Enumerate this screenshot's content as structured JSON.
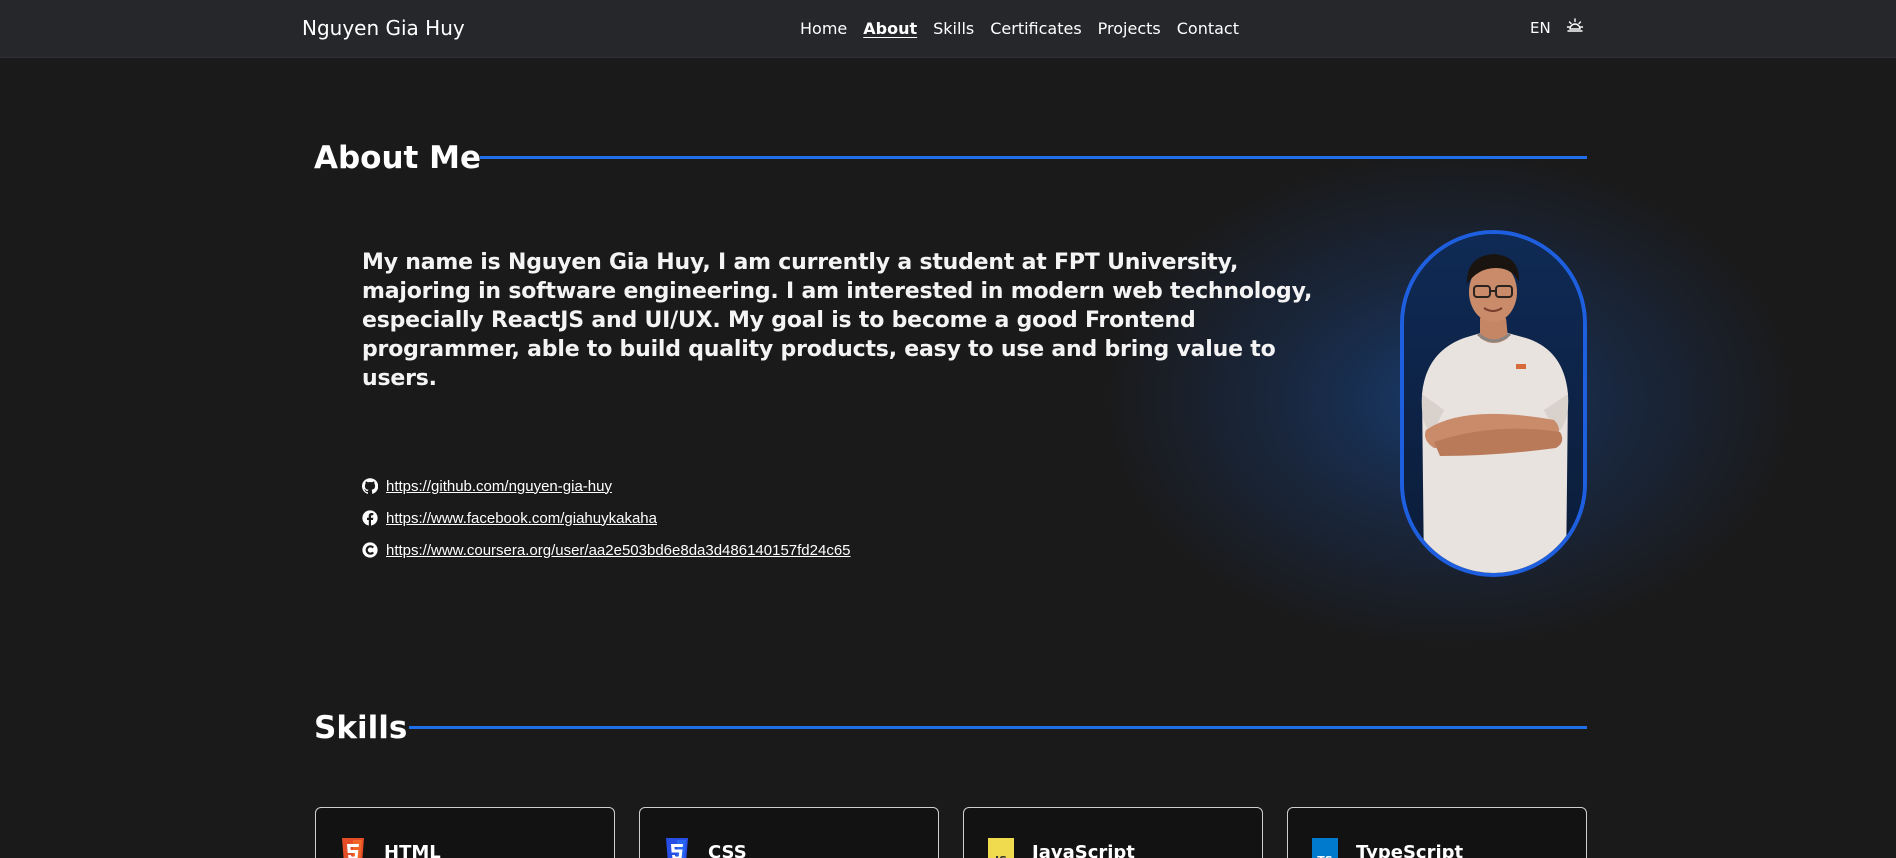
{
  "nav": {
    "brand": "Nguyen Gia Huy",
    "links": [
      "Home",
      "About",
      "Skills",
      "Certificates",
      "Projects",
      "Contact"
    ],
    "active": "About",
    "language": "EN",
    "theme_icon": "sun-icon"
  },
  "about": {
    "title": "About Me",
    "bio": "My name is Nguyen Gia Huy, I am currently a student at FPT University, majoring in software engineering. I am interested in modern web technology, especially ReactJS and UI/UX. My goal is to become a good Frontend programmer, able to build quality products, easy to use and bring value to users.",
    "links": [
      {
        "icon": "github-icon",
        "url": "https://github.com/nguyen-gia-huy"
      },
      {
        "icon": "facebook-icon",
        "url": "https://www.facebook.com/giahuykakaha"
      },
      {
        "icon": "coursera-icon",
        "url": "https://www.coursera.org/user/aa2e503bd6e8da3d486140157fd24c65"
      }
    ]
  },
  "skills": {
    "title": "Skills",
    "items": [
      {
        "name": "HTML",
        "icon": "html5-icon",
        "color": "#e44d26"
      },
      {
        "name": "CSS",
        "icon": "css3-icon",
        "color": "#264de4"
      },
      {
        "name": "JavaScript",
        "icon": "javascript-icon",
        "color": "#f0db4f"
      },
      {
        "name": "TypeScript",
        "icon": "typescript-icon",
        "color": "#007acc"
      }
    ]
  },
  "colors": {
    "accent": "#1e6fe8",
    "background": "#1a1a1a",
    "navbar": "#25272b"
  }
}
